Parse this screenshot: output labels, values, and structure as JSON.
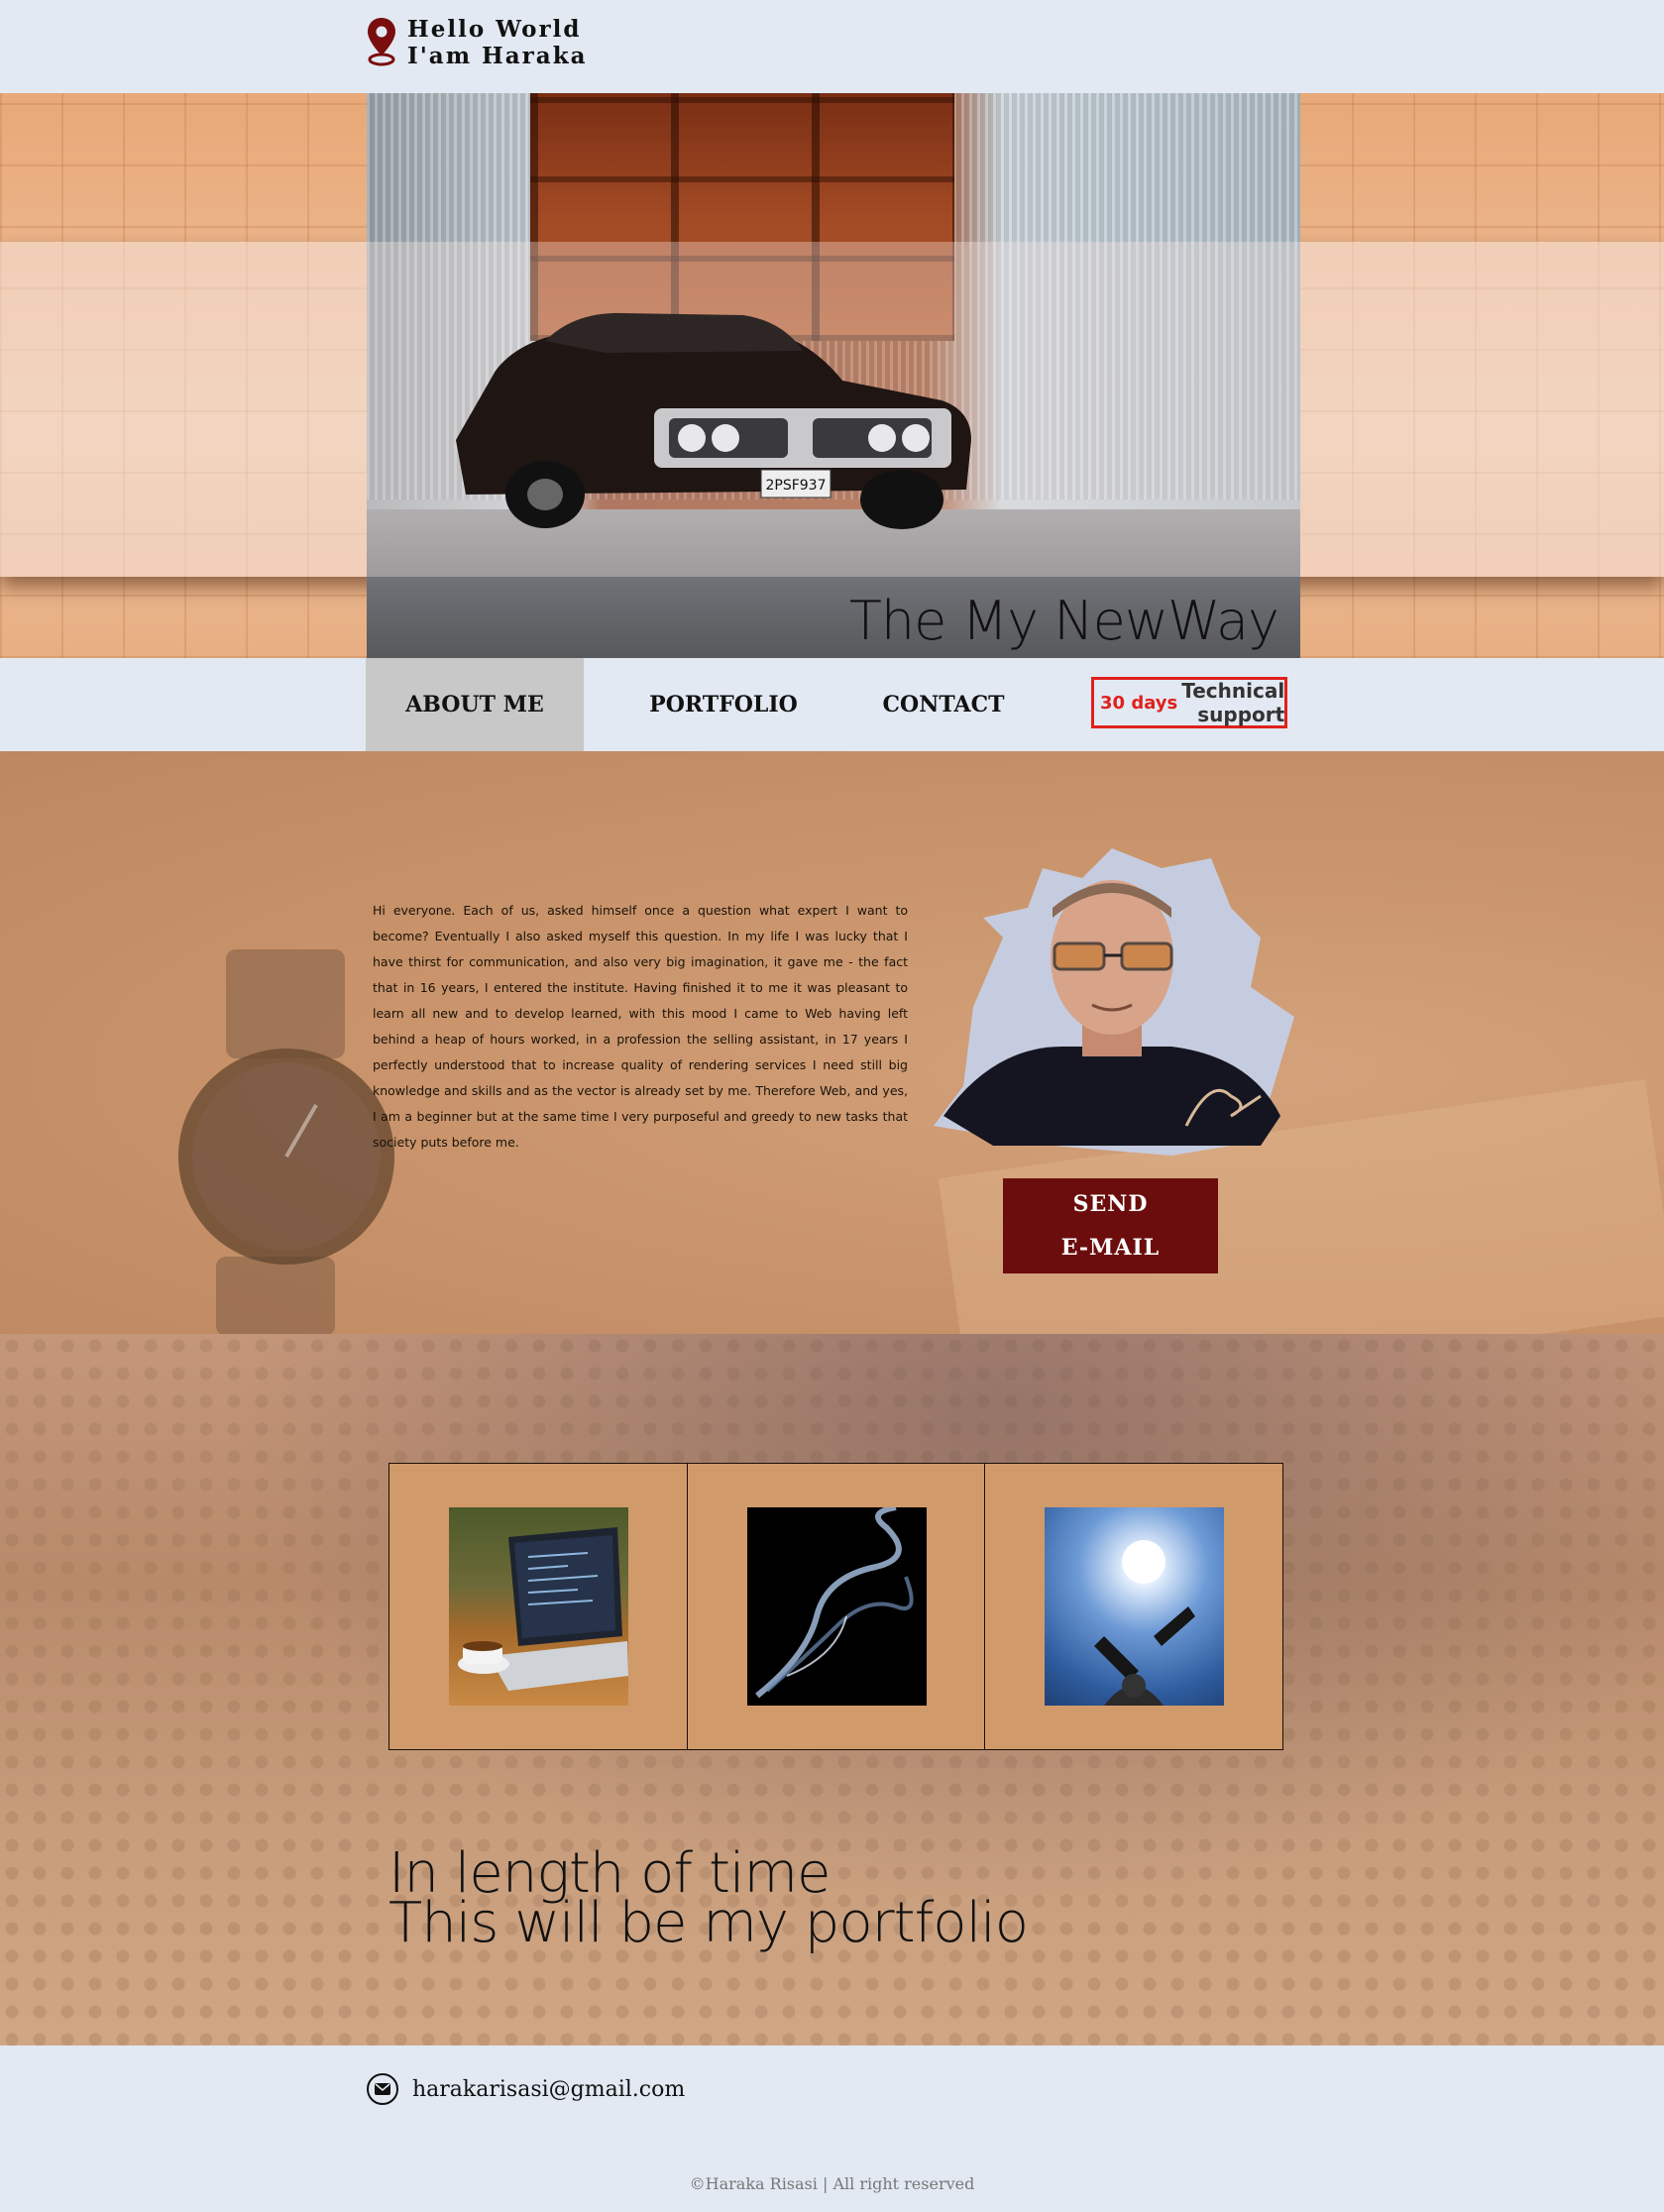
{
  "header": {
    "line1": "Hello World",
    "line2": "I'am Haraka"
  },
  "hero": {
    "title": "The My NewWay",
    "plate": "2PSF937"
  },
  "nav": {
    "items": [
      {
        "label": "ABOUT ME",
        "active": true
      },
      {
        "label": "PORTFOLIO",
        "active": false
      },
      {
        "label": "CONTACT",
        "active": false
      }
    ],
    "support": {
      "days": "30 days",
      "label_line1": "Technical",
      "label_line2": "support"
    }
  },
  "about": {
    "text": "Hi everyone. Each of us, asked himself once a question what expert I want to become? Eventually I also asked myself this question. In my life I was lucky that I have thirst for communication, and also very big imagination, it gave me - the fact that in 16 years, I entered the institute. Having finished it to me it was pleasant to learn all new and to develop learned, with this mood I came to Web having left behind a heap of hours worked, in a profession the selling assistant, in 17 years I perfectly understood that to increase quality of rendering services I need still big knowledge and skills and as the vector is already set by me. Therefore Web, and yes, I am a beginner but at the same time I very purposeful and greedy to new tasks that society puts before me.",
    "send_line1": "SEND",
    "send_line2": "E-MAIL"
  },
  "portfolio": {
    "tiles": [
      {
        "icon": "laptop-coffee-photo"
      },
      {
        "icon": "smoke-photo"
      },
      {
        "icon": "propeller-sky-photo"
      }
    ],
    "line1": "In length of time",
    "line2": "This will be my portfolio"
  },
  "footer": {
    "email": "harakarisasi@gmail.com",
    "copyright": "©Haraka Risasi | All right reserved"
  },
  "colors": {
    "accent_red": "#e0201b",
    "button": "#6b0d0d",
    "tile": "#d19a6a",
    "bg": "#e2e9f3"
  }
}
